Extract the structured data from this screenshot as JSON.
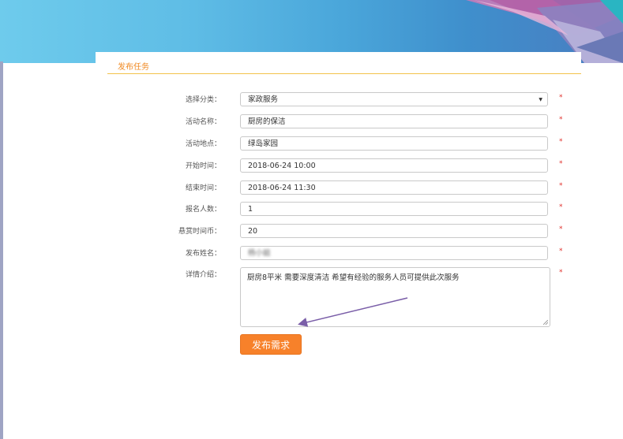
{
  "panel": {
    "title": "发布任务"
  },
  "form": {
    "category_label": "选择分类：",
    "category_value": "家政服务",
    "name_label": "活动名称：",
    "name_value": "厨房的保洁",
    "location_label": "活动地点：",
    "location_value": "绿岛家园",
    "start_label": "开始时间：",
    "start_value": "2018-06-24 10:00",
    "end_label": "结束时间：",
    "end_value": "2018-06-24 11:30",
    "count_label": "报名人数：",
    "count_value": "1",
    "reward_label": "悬赏时间币：",
    "reward_value": "20",
    "publisher_label": "发布姓名：",
    "publisher_value": "杨小姐",
    "detail_label": "详情介绍：",
    "detail_value": "厨房8平米 需要深度清洁 希望有经验的服务人员可提供此次服务",
    "required_mark": "*",
    "submit_label": "发布需求"
  },
  "colors": {
    "accent": "#f7812a",
    "title": "#f08a24",
    "required": "#e0302b",
    "banner": "#5fbde6"
  },
  "icons": {
    "select_arrow": "chevron-down-icon",
    "annotation": "arrow-annotation"
  }
}
